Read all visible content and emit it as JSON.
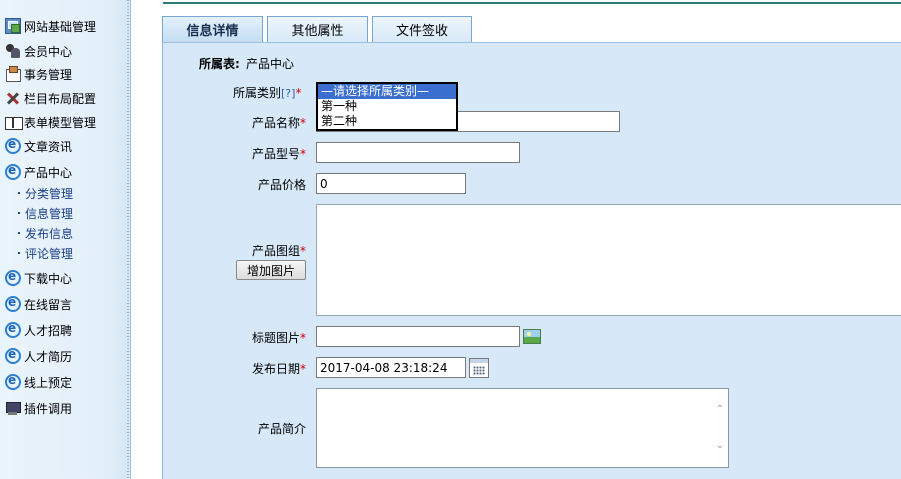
{
  "sidebar": {
    "items": [
      {
        "label": "网站基础管理",
        "icon": "network-icon"
      },
      {
        "label": "会员中心",
        "icon": "users-icon"
      },
      {
        "label": "事务管理",
        "icon": "task-icon"
      },
      {
        "label": "栏目布局配置",
        "icon": "tools-icon"
      },
      {
        "label": "表单模型管理",
        "icon": "book-icon"
      },
      {
        "label": "文章资讯",
        "icon": "ie-icon"
      },
      {
        "label": "产品中心",
        "icon": "ie-icon"
      },
      {
        "label": "下载中心",
        "icon": "ie-icon"
      },
      {
        "label": "在线留言",
        "icon": "ie-icon"
      },
      {
        "label": "人才招聘",
        "icon": "ie-icon"
      },
      {
        "label": "人才简历",
        "icon": "ie-icon"
      },
      {
        "label": "线上预定",
        "icon": "ie-icon"
      },
      {
        "label": "插件调用",
        "icon": "plugin-icon"
      }
    ],
    "sub_items": [
      {
        "label": "分类管理"
      },
      {
        "label": "信息管理"
      },
      {
        "label": "发布信息"
      },
      {
        "label": "评论管理"
      }
    ]
  },
  "tabs": [
    {
      "label": "信息详情",
      "active": true
    },
    {
      "label": "其他属性",
      "active": false
    },
    {
      "label": "文件签收",
      "active": false
    }
  ],
  "form": {
    "table_label": "所属表:",
    "table_value": "产品中心",
    "category": {
      "label": "所属类别",
      "help": "[?]",
      "options": [
        "—请选择所属类别—",
        "第一种",
        "第二种"
      ],
      "selected_index": 0
    },
    "product_name": {
      "label": "产品名称",
      "value": ""
    },
    "product_model": {
      "label": "产品型号",
      "value": ""
    },
    "product_price": {
      "label": "产品价格",
      "value": "0"
    },
    "product_images": {
      "label": "产品图组",
      "button": "增加图片"
    },
    "title_image": {
      "label": "标题图片",
      "value": ""
    },
    "publish_date": {
      "label": "发布日期",
      "value": "2017-04-08 23:18:24"
    },
    "summary": {
      "label": "产品简介",
      "value": ""
    },
    "required_mark": "*"
  },
  "colors": {
    "panel_bg": "#d7e8f8",
    "sidebar_bg": "#e2eef9",
    "required": "#cc0000",
    "selected_option": "#3a6fd0",
    "top_line": "#2a7d7a"
  }
}
